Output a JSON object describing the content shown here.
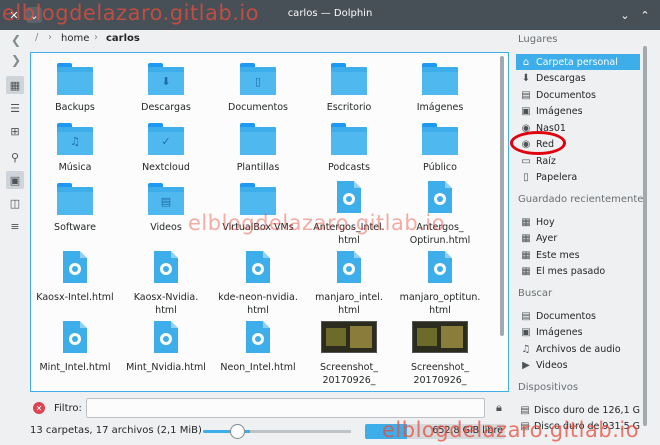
{
  "window": {
    "title": "carlos — Dolphin",
    "watermark": "elblogdelazaro.gitlab.io"
  },
  "breadcrumb": {
    "root": "/",
    "home": "home",
    "current": "carlos"
  },
  "files": [
    {
      "label": "Backups",
      "kind": "folder",
      "glyph": ""
    },
    {
      "label": "Descargas",
      "kind": "folder",
      "glyph": "⬇"
    },
    {
      "label": "Documentos",
      "kind": "folder",
      "glyph": "▯"
    },
    {
      "label": "Escritorio",
      "kind": "folder",
      "glyph": ""
    },
    {
      "label": "Imágenes",
      "kind": "folder",
      "glyph": ""
    },
    {
      "label": "Música",
      "kind": "folder",
      "glyph": "♫"
    },
    {
      "label": "Nextcloud",
      "kind": "folder",
      "glyph": "✓"
    },
    {
      "label": "Plantillas",
      "kind": "folder",
      "glyph": ""
    },
    {
      "label": "Podcasts",
      "kind": "folder",
      "glyph": ""
    },
    {
      "label": "Público",
      "kind": "folder",
      "glyph": ""
    },
    {
      "label": "Software",
      "kind": "folder",
      "glyph": ""
    },
    {
      "label": "Videos",
      "kind": "folder",
      "glyph": "▤"
    },
    {
      "label": "VirtualBox VMs",
      "kind": "folder",
      "glyph": ""
    },
    {
      "label": "Antergos_Intel.\nhtml",
      "kind": "html",
      "glyph": ""
    },
    {
      "label": "Antergos_\nOptirun.html",
      "kind": "html",
      "glyph": ""
    },
    {
      "label": "Kaosx-Intel.html",
      "kind": "html",
      "glyph": ""
    },
    {
      "label": "Kaosx-Nvidia.\nhtml",
      "kind": "html",
      "glyph": ""
    },
    {
      "label": "kde-neon-nvidia.\nhtml",
      "kind": "html",
      "glyph": ""
    },
    {
      "label": "manjaro_intel.\nhtml",
      "kind": "html",
      "glyph": ""
    },
    {
      "label": "manjaro_optitun.\nhtml",
      "kind": "html",
      "glyph": ""
    },
    {
      "label": "Mint_Intel.html",
      "kind": "html",
      "glyph": ""
    },
    {
      "label": "Mint_Nvidia.html",
      "kind": "html",
      "glyph": ""
    },
    {
      "label": "Neon_Intel.html",
      "kind": "html",
      "glyph": ""
    },
    {
      "label": "Screenshot_\n20170926_",
      "kind": "image",
      "glyph": ""
    },
    {
      "label": "Screenshot_\n20170926_",
      "kind": "image",
      "glyph": ""
    }
  ],
  "filter": {
    "label": "Filtro:",
    "value": "",
    "placeholder": ""
  },
  "status": {
    "summary": "13 carpetas, 17 archivos (2,1 MiB)",
    "zoom_fraction": 0.23,
    "free_space": "652,8 GiB libre",
    "used_fraction": 0.3
  },
  "places": {
    "sections": [
      {
        "heading": "Lugares",
        "items": [
          {
            "label": "Carpeta personal",
            "icon": "home-icon",
            "glyph": "⌂",
            "selected": true
          },
          {
            "label": "Descargas",
            "icon": "download-icon",
            "glyph": "⬇",
            "selected": false
          },
          {
            "label": "Documentos",
            "icon": "document-icon",
            "glyph": "▤",
            "selected": false
          },
          {
            "label": "Imágenes",
            "icon": "image-icon",
            "glyph": "▣",
            "selected": false
          },
          {
            "label": "Nas01",
            "icon": "network-icon",
            "glyph": "◉",
            "selected": false
          },
          {
            "label": "Red",
            "icon": "network-folder-icon",
            "glyph": "◉",
            "selected": false
          },
          {
            "label": "Raíz",
            "icon": "root-icon",
            "glyph": "▭",
            "selected": false
          },
          {
            "label": "Papelera",
            "icon": "trash-icon",
            "glyph": "▯",
            "selected": false
          }
        ]
      },
      {
        "heading": "Guardado recientemente",
        "items": [
          {
            "label": "Hoy",
            "icon": "calendar-icon",
            "glyph": "▦",
            "selected": false
          },
          {
            "label": "Ayer",
            "icon": "calendar-icon",
            "glyph": "▦",
            "selected": false
          },
          {
            "label": "Este mes",
            "icon": "calendar-icon",
            "glyph": "▦",
            "selected": false
          },
          {
            "label": "El mes pasado",
            "icon": "calendar-icon",
            "glyph": "▦",
            "selected": false
          }
        ]
      },
      {
        "heading": "Buscar",
        "items": [
          {
            "label": "Documentos",
            "icon": "document-icon",
            "glyph": "▤",
            "selected": false
          },
          {
            "label": "Imágenes",
            "icon": "image-icon",
            "glyph": "▣",
            "selected": false
          },
          {
            "label": "Archivos de audio",
            "icon": "audio-icon",
            "glyph": "♫",
            "selected": false
          },
          {
            "label": "Videos",
            "icon": "video-icon",
            "glyph": "▶",
            "selected": false
          }
        ]
      },
      {
        "heading": "Dispositivos",
        "items": [
          {
            "label": "Disco duro de 126,1 G",
            "icon": "harddisk-icon",
            "glyph": "▤",
            "selected": false
          },
          {
            "label": "Disco duro de 931,5 G",
            "icon": "harddisk-icon",
            "glyph": "▤",
            "selected": false
          }
        ]
      }
    ]
  },
  "colors": {
    "accent": "#3daee9",
    "folder": "#3daee9",
    "titlebar": "#475057",
    "highlight_ring": "#e0000e"
  }
}
